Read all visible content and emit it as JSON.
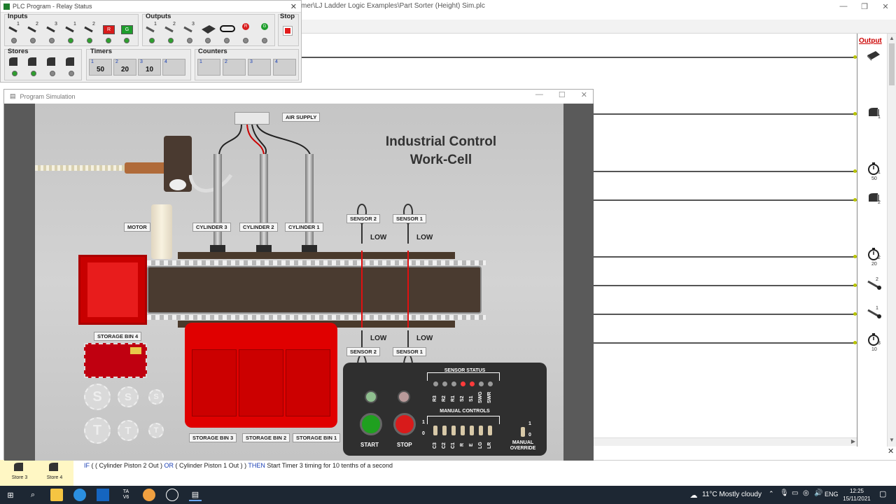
{
  "main_window": {
    "path_fragment": "mer\\LJ Ladder Logic Examples\\Part Sorter (Height) Sim.plc",
    "minimize": "—",
    "maximize": "❐",
    "close": "✕"
  },
  "relay_status": {
    "title": "PLC Program - Relay Status",
    "groups": {
      "inputs": "Inputs",
      "outputs": "Outputs",
      "stop": "Stop",
      "stores": "Stores",
      "timers": "Timers",
      "counters": "Counters"
    },
    "input_numbers": [
      "1",
      "2",
      "3",
      "1",
      "2"
    ],
    "output_numbers": [
      "1",
      "2",
      "3"
    ],
    "input_r_label": "R",
    "input_g_label": "G",
    "output_r_label": "R",
    "output_g_label": "G",
    "store_numbers": [
      "1",
      "2",
      "3",
      "4"
    ],
    "timers": [
      {
        "num": "1",
        "value": "50"
      },
      {
        "num": "2",
        "value": "20"
      },
      {
        "num": "3",
        "value": "10"
      },
      {
        "num": "4",
        "value": ""
      }
    ],
    "counters": [
      {
        "num": "1",
        "value": ""
      },
      {
        "num": "2",
        "value": ""
      },
      {
        "num": "3",
        "value": ""
      },
      {
        "num": "4",
        "value": ""
      }
    ]
  },
  "simulation": {
    "title": "Program Simulation",
    "scene_title_line1": "Industrial Control",
    "scene_title_line2": "Work-Cell",
    "air_supply": "AIR SUPPLY",
    "motor": "MOTOR",
    "cylinders": [
      "CYLINDER 3",
      "CYLINDER 2",
      "CYLINDER 1"
    ],
    "sensor_top": [
      "SENSOR 2",
      "SENSOR 1"
    ],
    "sensor_bottom": [
      "SENSOR 2",
      "SENSOR 1"
    ],
    "low": "LOW",
    "bin4": "STORAGE BIN 4",
    "bins": [
      "STORAGE BIN 3",
      "STORAGE BIN 2",
      "STORAGE BIN 1"
    ],
    "lid_sticker": "",
    "s_buttons": [
      "S",
      "S",
      "S"
    ],
    "t_buttons": [
      "T",
      "T",
      "T"
    ],
    "panel": {
      "sensor_status": "SENSOR STATUS",
      "sensor_labels": [
        "R3",
        "R2",
        "R1",
        "S2",
        "S1",
        "SWG",
        "SWR"
      ],
      "sensor_led_states": [
        "off",
        "off",
        "off",
        "on",
        "on",
        "off",
        "off"
      ],
      "manual_controls": "MANUAL CONTROLS",
      "control_labels": [
        "C3",
        "C2",
        "C1",
        "R",
        "E",
        "LG",
        "LR"
      ],
      "scale_top": "1",
      "scale_bottom": "0",
      "start": "START",
      "stop": "STOP",
      "manual_override": "MANUAL OVERRIDE",
      "override_top": "1",
      "override_bottom": "0"
    }
  },
  "ladder": {
    "output_header": "Output",
    "outputs": [
      {
        "icon": "conveyor-icon",
        "num": ""
      },
      {
        "icon": "store-icon",
        "num": "1"
      },
      {
        "icon": "timer-icon",
        "num": "1",
        "preset": "50"
      },
      {
        "icon": "store-icon",
        "num": "2"
      },
      {
        "icon": "timer-icon",
        "num": "2",
        "preset": "20"
      },
      {
        "icon": "cylinder-icon",
        "num": "2"
      },
      {
        "icon": "cylinder-icon",
        "num": "1"
      },
      {
        "icon": "timer-icon",
        "num": "3",
        "preset": "10"
      }
    ]
  },
  "status_bar": {
    "stores": [
      {
        "num": "3",
        "label": "Store 3"
      },
      {
        "num": "4",
        "label": "Store 4"
      }
    ],
    "kw_if": "IF",
    "p1": " ( ( Cylinder Piston 2 Out ) ",
    "kw_or": "OR",
    "p2": " ( Cylinder Piston 1 Out ) ) ",
    "kw_then": "THEN",
    "p3": " Start Timer 3 timing for 10 tenths of a second"
  },
  "taskbar": {
    "weather": "11°C  Mostly cloudy",
    "lang": "ENG",
    "time": "12:25",
    "date": "15/11/2021",
    "app_ta_label": "TA\nV6"
  },
  "colors": {
    "led_on": "#2ea02e",
    "accent_red": "#e00000",
    "taskbar": "#1d2733"
  }
}
